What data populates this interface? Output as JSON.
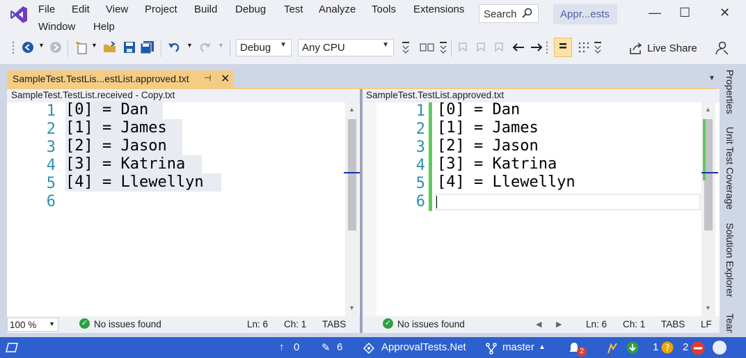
{
  "menu": {
    "row1": [
      "File",
      "Edit",
      "View",
      "Project",
      "Build",
      "Debug",
      "Test",
      "Analyze",
      "Tools",
      "Extensions"
    ],
    "row2": [
      "Window",
      "Help"
    ]
  },
  "search": {
    "label": "Search",
    "icon": "magnifier-icon"
  },
  "solution_name": "Appr...ests",
  "window_controls": {
    "minimize": "—",
    "maximize": "☐",
    "close": "✕"
  },
  "toolbar": {
    "config": "Debug",
    "platform": "Any CPU",
    "live_share": "Live Share"
  },
  "document_tab": {
    "title": "SampleTest.TestLis...estList.approved.txt",
    "pin": "⊣",
    "close": "✕"
  },
  "right_rail": [
    "Properties",
    "Unit Test Coverage",
    "Solution Explorer",
    "Team"
  ],
  "left_pane": {
    "title": "SampleTest.TestList.received - Copy.txt",
    "line_numbers": [
      "1",
      "2",
      "3",
      "4",
      "5",
      "6"
    ],
    "lines": [
      "[0] = Dan",
      "[1] = James",
      "[2] = Jason",
      "[3] = Katrina",
      "[4] = Llewellyn",
      ""
    ],
    "zoom": "100 %",
    "issues": "No issues found",
    "ln": "Ln: 6",
    "ch": "Ch: 1",
    "tabs": "TABS"
  },
  "right_pane": {
    "title": "SampleTest.TestList.approved.txt",
    "line_numbers": [
      "1",
      "2",
      "3",
      "4",
      "5",
      "6"
    ],
    "lines": [
      "[0] = Dan",
      "[1] = James",
      "[2] = Jason",
      "[3] = Katrina",
      "[4] = Llewellyn",
      ""
    ],
    "issues": "No issues found",
    "ln": "Ln: 6",
    "ch": "Ch: 1",
    "tabs": "TABS",
    "eol": "LF"
  },
  "statusbar": {
    "up_count": "0",
    "edits_count": "6",
    "repo": "ApprovalTests.Net",
    "branch": "master",
    "notifications": "2",
    "count_a": "1",
    "count_b": "2"
  },
  "colors": {
    "accent": "#2d5fcf",
    "tab_active": "#f5cc84",
    "diff_added": "#5ccc5c",
    "line_number": "#2b91af"
  }
}
